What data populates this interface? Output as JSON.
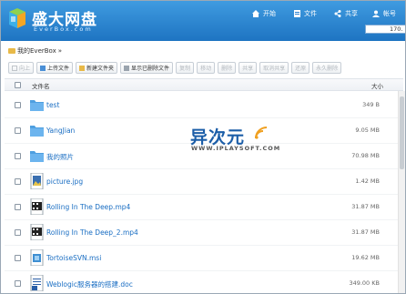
{
  "app": {
    "title": "盛大网盘",
    "subtitle": "EverBox.com"
  },
  "nav": [
    {
      "label": "开始",
      "icon": "home-icon"
    },
    {
      "label": "文件",
      "icon": "file-icon"
    },
    {
      "label": "共享",
      "icon": "share-icon"
    },
    {
      "label": "帐号",
      "icon": "user-icon"
    }
  ],
  "quota": {
    "text": "170.",
    "fill": 0.05
  },
  "breadcrumb": {
    "text": "我的EverBox",
    "sep": "»"
  },
  "toolbar": [
    {
      "label": "向上",
      "enabled": false
    },
    {
      "label": "上传文件",
      "enabled": true
    },
    {
      "label": "新建文件夹",
      "enabled": true
    },
    {
      "label": "显示已删除文件",
      "enabled": true
    },
    {
      "label": "复制",
      "enabled": false
    },
    {
      "label": "移动",
      "enabled": false
    },
    {
      "label": "删除",
      "enabled": false
    },
    {
      "label": "共享",
      "enabled": false
    },
    {
      "label": "取消共享",
      "enabled": false
    },
    {
      "label": "还原",
      "enabled": false
    },
    {
      "label": "永久删除",
      "enabled": false
    }
  ],
  "table": {
    "headers": {
      "name": "文件名",
      "size": "大小"
    },
    "rows": [
      {
        "name": "test",
        "size": "349 B",
        "type": "folder"
      },
      {
        "name": "YangJian",
        "size": "9.05 MB",
        "type": "folder"
      },
      {
        "name": "我的照片",
        "size": "70.98 MB",
        "type": "folder"
      },
      {
        "name": "picture.jpg",
        "size": "1.42 MB",
        "type": "image"
      },
      {
        "name": "Rolling In The Deep.mp4",
        "size": "31.87 MB",
        "type": "video"
      },
      {
        "name": "Rolling In The Deep_2.mp4",
        "size": "31.87 MB",
        "type": "video"
      },
      {
        "name": "TortoiseSVN.msi",
        "size": "19.62 MB",
        "type": "msi"
      },
      {
        "name": "Weblogic服务器的搭建.doc",
        "size": "349.00 KB",
        "type": "doc"
      }
    ]
  },
  "watermark": {
    "title": "异次元",
    "sub": "WWW.IPLAYSOFT.COM"
  },
  "colors": {
    "header_top": "#3f9be0",
    "header_bottom": "#1e74c2",
    "link": "#1a6ec3",
    "folder": "#5aa9e6"
  }
}
